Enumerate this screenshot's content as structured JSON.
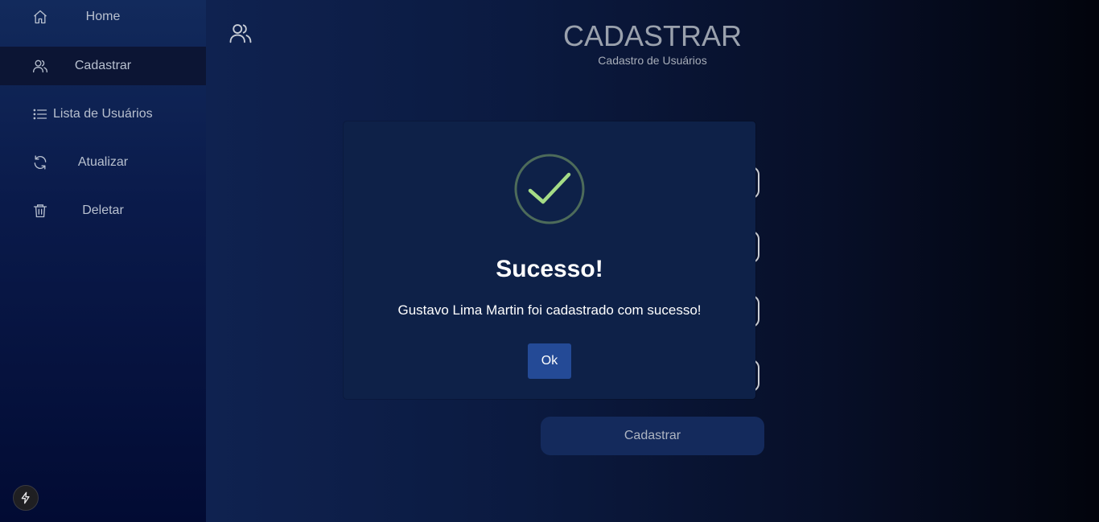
{
  "sidebar": {
    "items": [
      {
        "label": "Home",
        "icon": "home-icon"
      },
      {
        "label": "Cadastrar",
        "icon": "users-icon"
      },
      {
        "label": "Lista de Usuários",
        "icon": "list-icon"
      },
      {
        "label": "Atualizar",
        "icon": "refresh-icon"
      },
      {
        "label": "Deletar",
        "icon": "trash-icon"
      }
    ],
    "active": "Cadastrar"
  },
  "header": {
    "title": "CADASTRAR",
    "subtitle": "Cadastro de Usuários"
  },
  "form": {
    "submit_label": "Cadastrar"
  },
  "modal": {
    "title": "Sucesso!",
    "message": "Gustavo Lima Martin foi cadastrado com sucesso!",
    "ok_label": "Ok",
    "icon": "check-icon"
  },
  "colors": {
    "accent": "#244a96",
    "success": "#a5dc86",
    "modal_bg": "#0e2148"
  }
}
